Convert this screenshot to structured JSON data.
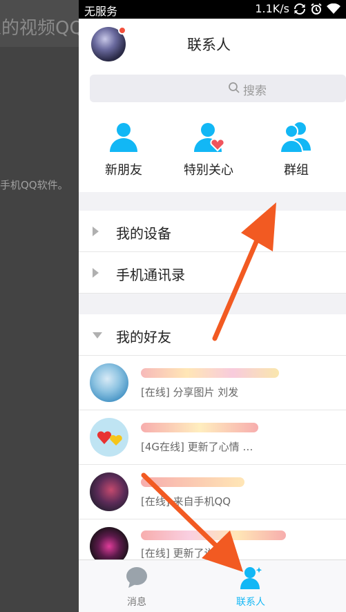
{
  "background": {
    "title_fragment": "家的视频QQ",
    "text_fragment": "手机QQ软件。"
  },
  "statusbar": {
    "carrier": "无服务",
    "speed": "1.1K/s"
  },
  "header": {
    "title": "联系人"
  },
  "search": {
    "placeholder": "搜索"
  },
  "quick_actions": [
    {
      "label": "新朋友",
      "icon": "person-icon"
    },
    {
      "label": "特别关心",
      "icon": "person-heart-icon"
    },
    {
      "label": "群组",
      "icon": "group-icon"
    }
  ],
  "groups": [
    {
      "label": "我的设备",
      "expanded": false
    },
    {
      "label": "手机通讯录",
      "expanded": false
    },
    {
      "label": "我的好友",
      "expanded": true
    }
  ],
  "friends": [
    {
      "status": "[在线] 分享图片 刘发"
    },
    {
      "status": "[4G在线] 更新了心情 …"
    },
    {
      "status": "[在线] 来自手机QQ"
    },
    {
      "status": "[在线] 更新了说说"
    }
  ],
  "tabs": [
    {
      "label": "消息",
      "active": false
    },
    {
      "label": "联系人",
      "active": true
    }
  ],
  "colors": {
    "accent": "#12b7f5",
    "annotation_arrow": "#f25a22",
    "badge": "#f2503c",
    "heart": "#f0545d"
  }
}
